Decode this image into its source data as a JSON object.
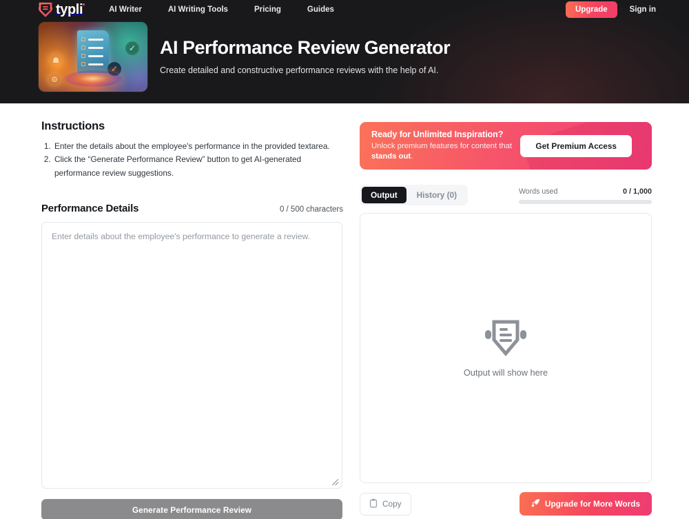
{
  "nav": {
    "brand": "typli",
    "brand_icon": "typli-shield-logo",
    "links": [
      {
        "label": "AI Writer"
      },
      {
        "label": "AI Writing Tools"
      },
      {
        "label": "Pricing"
      },
      {
        "label": "Guides"
      }
    ],
    "upgrade_label": "Upgrade",
    "signin_label": "Sign in"
  },
  "hero": {
    "title": "AI Performance Review Generator",
    "subtitle": "Create detailed and constructive performance reviews with the help of AI.",
    "thumbnail_alt": "ai-checklist-illustration"
  },
  "instructions": {
    "heading": "Instructions",
    "steps": [
      "Enter the details about the employee's performance in the provided textarea.",
      "Click the “Generate Performance Review” button to get AI-generated performance review suggestions."
    ]
  },
  "form": {
    "label": "Performance Details",
    "char_counter": "0 / 500 characters",
    "textarea_value": "",
    "textarea_placeholder": "Enter details about the employee's performance to generate a review.",
    "submit_label": "Generate Performance Review",
    "submit_disabled": true
  },
  "promo": {
    "title": "Ready for Unlimited Inspiration?",
    "subtitle_part1": "Unlock premium features for content that ",
    "subtitle_bold": "stands out",
    "subtitle_part2": ".",
    "cta_label": "Get Premium Access"
  },
  "output": {
    "tabs": [
      {
        "label": "Output",
        "active": true
      },
      {
        "label": "History (0)",
        "active": false
      }
    ],
    "words_label": "Words used",
    "words_value": "0 / 1,000",
    "words_progress_percent": 0,
    "empty_text": "Output will show here",
    "empty_icon": "typli-shield-document-icon",
    "copy_label": "Copy",
    "copy_icon": "clipboard-icon",
    "upgrade_label": "Upgrade for More Words",
    "upgrade_icon": "rocket-icon"
  },
  "colors": {
    "header_bg": "#19191b",
    "accent_start": "#fb7055",
    "accent_end": "#ef3f6b",
    "tab_active_bg": "#16181c",
    "disabled_button": "#8b8b8d",
    "muted_text": "#6b737b"
  }
}
